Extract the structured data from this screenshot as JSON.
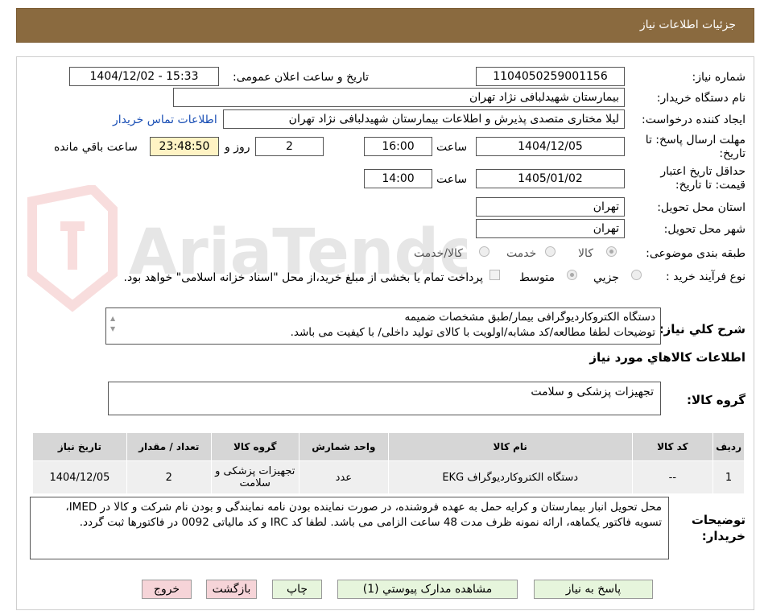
{
  "header": {
    "title": "جزئیات اطلاعات نیاز"
  },
  "form": {
    "need_number": {
      "label": "شماره نیاز:",
      "value": "1104050259001156"
    },
    "announce_datetime": {
      "label": "تاریخ و ساعت اعلان عمومی:",
      "value": "1404/12/02 - 15:33"
    },
    "buyer_org": {
      "label": "نام دستگاه خریدار:",
      "value": "بیمارستان شهیدلبافی نژاد تهران"
    },
    "requester": {
      "label": "ایجاد کننده درخواست:",
      "value": "لیلا مختاری متصدی پذیرش و اطلاعات بیمارستان شهیدلبافی نژاد تهران",
      "contact_link": "اطلاعات تماس خریدار"
    },
    "deadline": {
      "label": "مهلت ارسال پاسخ: تا تاریخ:",
      "date": "1404/12/05",
      "time_label": "ساعت",
      "time": "16:00",
      "days": "2",
      "days_label": "روز و",
      "remaining": "23:48:50",
      "remaining_label": "ساعت باقي مانده"
    },
    "price_validity": {
      "label": "حداقل تاریخ اعتبار قیمت: تا تاریخ:",
      "date": "1405/01/02",
      "time_label": "ساعت",
      "time": "14:00"
    },
    "province": {
      "label": "استان محل تحویل:",
      "value": "تهران"
    },
    "city": {
      "label": "شهر محل تحویل:",
      "value": "تهران"
    },
    "category": {
      "label": "طبقه بندی موضوعی:",
      "options": [
        "کالا",
        "خدمت",
        "کالا/خدمت"
      ],
      "selected": "کالا"
    },
    "purchase_type": {
      "label": "نوع فرآیند خرید :",
      "options": [
        "جزیي",
        "متوسط"
      ],
      "selected": "متوسط",
      "treasury_note": "پرداخت تمام یا بخشی از مبلغ خرید،از محل \"اسناد خزانه اسلامی\" خواهد بود."
    }
  },
  "description": {
    "label": "شرح کلي نیاز:",
    "line1": "دستگاه الکتروکاردیوگرافی بیمار/طبق مشخصات ضمیمه",
    "line2": "توضیحات لطفا مطالعه/کد مشابه/اولویت با کالای تولید داخلی/ با کیفیت می باشد."
  },
  "goods_section": {
    "title": "اطلاعات کالاهاي مورد نیاز"
  },
  "goods_group": {
    "label": "گروه کالا:",
    "value": "تجهیزات پزشکی و سلامت"
  },
  "table": {
    "columns": [
      "ردیف",
      "کد کالا",
      "نام کالا",
      "واحد شمارش",
      "گروه کالا",
      "تعداد / مقدار",
      "تاریخ نیاز"
    ],
    "rows": [
      [
        "1",
        "--",
        "دستگاه الکتروکاردیوگراف EKG",
        "عدد",
        "تجهیزات پزشکی و سلامت",
        "2",
        "1404/12/05"
      ]
    ]
  },
  "buyer_notes": {
    "label": "توضیحات خریدار:",
    "text": "محل تحویل انبار بیمارستان و کرایه حمل به عهده فروشنده، در صورت نماینده بودن نامه نمایندگی و بودن نام شرکت و کالا در IMED، تسویه فاکتور یکماهه، ارائه نمونه ظرف مدت 48 ساعت الزامی می باشد. لطفا کد IRC و کد مالیاتی 0092 در فاکتورها ثبت گردد."
  },
  "buttons": {
    "reply": "پاسخ به نیاز",
    "view_docs": "مشاهده مدارک پیوستي (1)",
    "print": "چاپ",
    "back": "بازگشت",
    "exit": "خروج"
  },
  "watermark": {
    "text": "AriaTender.neT"
  }
}
